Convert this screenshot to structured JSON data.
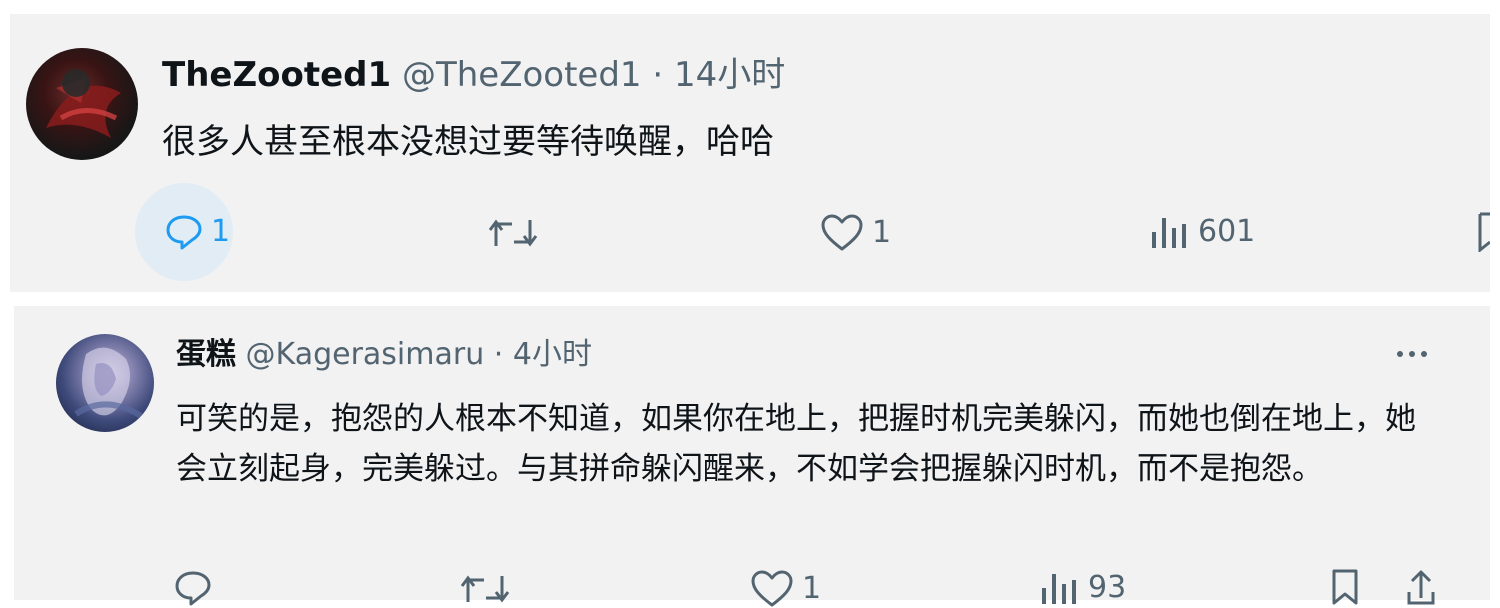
{
  "tweets": [
    {
      "display_name": "TheZooted1",
      "handle": "@TheZooted1",
      "separator": "·",
      "time": "14小时",
      "text": "很多人甚至根本没想过要等待唤醒，哈哈",
      "actions": {
        "reply_count": "1",
        "retweet_count": "",
        "like_count": "1",
        "views_count": "601"
      },
      "icons": [
        "reply-icon",
        "retweet-icon",
        "like-icon",
        "views-icon",
        "bookmark-icon"
      ],
      "accent_color": "#1d9bf0"
    },
    {
      "display_name": "蛋糕",
      "handle": "@Kagerasimaru",
      "separator": "·",
      "time": "4小时",
      "text": "可笑的是，抱怨的人根本不知道，如果你在地上，把握时机完美躲闪，而她也倒在地上，她会立刻起身，完美躲过。与其拼命躲闪醒来，不如学会把握躲闪时机，而不是抱怨。",
      "actions": {
        "reply_count": "",
        "retweet_count": "",
        "like_count": "1",
        "views_count": "93"
      },
      "icons": [
        "more-icon",
        "reply-icon",
        "retweet-icon",
        "like-icon",
        "views-icon",
        "bookmark-icon",
        "share-icon"
      ]
    }
  ],
  "colors": {
    "text_primary": "#0f1419",
    "text_secondary": "#536471",
    "background": "#f2f2f2",
    "accent": "#1d9bf0"
  }
}
